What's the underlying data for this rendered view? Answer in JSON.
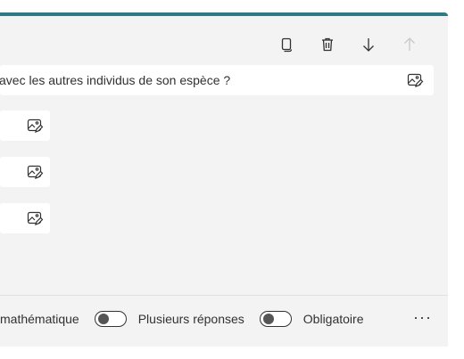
{
  "question": {
    "text": "avec les autres individus de son espèce ?"
  },
  "toolbar": {
    "icons": [
      "copy-icon",
      "delete-icon",
      "move-down-icon",
      "move-up-icon"
    ]
  },
  "footer": {
    "math_label": "mathématique",
    "multiple_label": "Plusieurs réponses",
    "required_label": "Obligatoire",
    "more_label": "···"
  },
  "colors": {
    "accent": "#2b7a84",
    "card_bg": "#f3f3f3"
  }
}
